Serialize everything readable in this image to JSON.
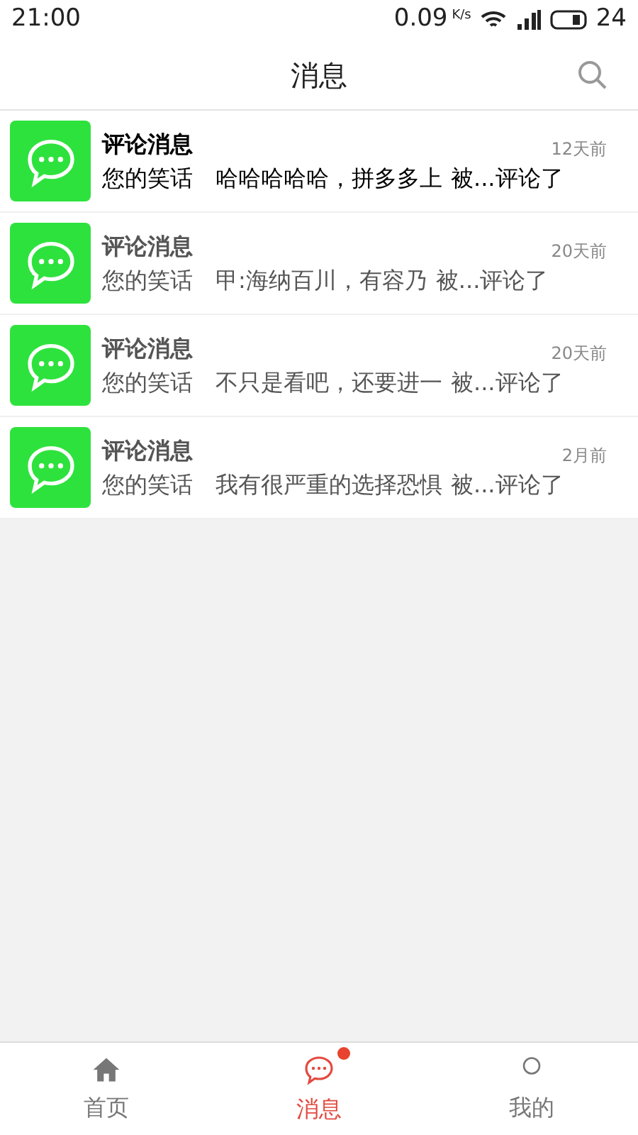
{
  "status_bar": {
    "time": "21:00",
    "speed": "0.09",
    "speed_unit": "K/s",
    "battery": "24"
  },
  "header": {
    "title": "消息"
  },
  "messages": [
    {
      "title": "评论消息",
      "time": "12天前",
      "source": "您的笑话",
      "preview": "哈哈哈哈哈，拼多多上",
      "suffix": "被...评论了",
      "unread": true
    },
    {
      "title": "评论消息",
      "time": "20天前",
      "source": "您的笑话",
      "preview": "甲:海纳百川，有容乃",
      "suffix": "被...评论了",
      "unread": false
    },
    {
      "title": "评论消息",
      "time": "20天前",
      "source": "您的笑话",
      "preview": "不只是看吧，还要进一",
      "suffix": "被...评论了",
      "unread": false
    },
    {
      "title": "评论消息",
      "time": "2月前",
      "source": "您的笑话",
      "preview": "我有很严重的选择恐惧",
      "suffix": "被...评论了",
      "unread": false
    }
  ],
  "tabs": [
    {
      "label": "首页",
      "kind": "home",
      "selected": false,
      "badge": false
    },
    {
      "label": "消息",
      "kind": "messages",
      "selected": true,
      "badge": true
    },
    {
      "label": "我的",
      "kind": "profile",
      "selected": false,
      "badge": false
    }
  ]
}
